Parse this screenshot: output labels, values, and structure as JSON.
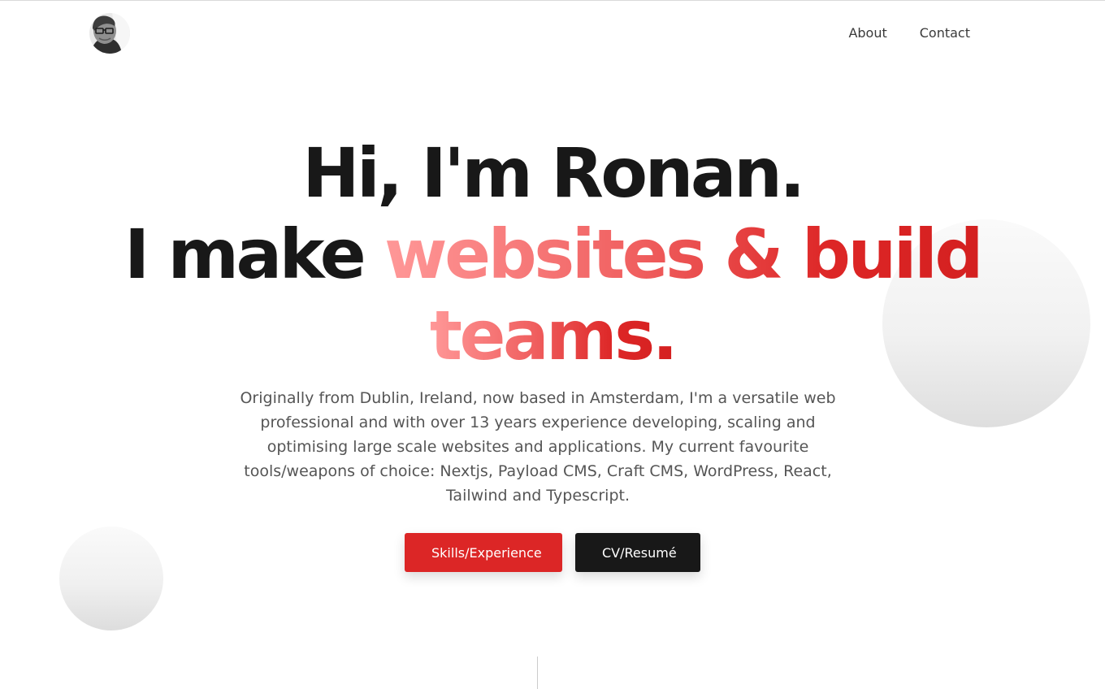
{
  "header": {
    "nav": [
      {
        "label": "About"
      },
      {
        "label": "Contact"
      }
    ]
  },
  "hero": {
    "line1": "Hi, I'm Ronan.",
    "line2_prefix": "I make ",
    "accent_line2": "websites & build",
    "accent_line3": "teams.",
    "intro": "Originally from Dublin, Ireland, now based in Amsterdam, I'm a versatile web professional and with over 13 years experience developing, scaling and optimising large scale websites and applications. My current favourite tools/weapons of choice: Nextjs, Payload CMS, Craft CMS, WordPress, React, Tailwind and Typescript."
  },
  "buttons": {
    "primary": "Skills/Experience",
    "secondary": "CV/Resumé"
  },
  "colors": {
    "accent_start": "#ff9898",
    "accent_end": "#d42020",
    "primary_button": "#dc2626",
    "dark_button": "#181818",
    "text": "#181818"
  }
}
